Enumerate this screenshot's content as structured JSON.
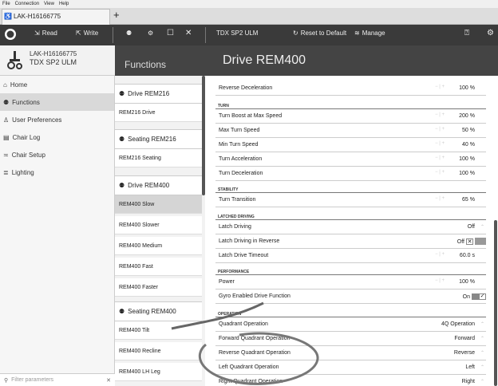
{
  "menu": [
    "File",
    "Connection",
    "View",
    "Help"
  ],
  "doc_tab": "LAK-H16166775",
  "add_tab": "+",
  "toolbar": {
    "read": "Read",
    "write": "Write",
    "product": "TDX SP2 ULM",
    "reset": "Reset to Default",
    "manage": "Manage"
  },
  "device": {
    "serial": "LAK-H16166775",
    "model": "TDX SP2 ULM"
  },
  "nav": [
    "Home",
    "Functions",
    "User Preferences",
    "Chair Log",
    "Chair Setup",
    "Lighting"
  ],
  "filter": {
    "placeholder": "Filter parameters",
    "clear": "✕"
  },
  "functions": {
    "title": "Functions",
    "groups": [
      "Drive REM216",
      "Seating REM216",
      "Drive REM400",
      "Seating REM400"
    ],
    "items": [
      "REM216 Drive",
      "REM216 Seating",
      "REM400 Slow",
      "REM400 Slower",
      "REM400 Medium",
      "REM400 Fast",
      "REM400 Faster",
      "REM400 Tilt",
      "REM400 Recline",
      "REM400 LH Leg"
    ]
  },
  "page_title": "Drive REM400",
  "sections": [
    "TURN",
    "STABILITY",
    "LATCHED DRIVING",
    "PERFORMANCE",
    "OPERATION"
  ],
  "params": [
    {
      "label": "Reverse Deceleration",
      "value": "100 %"
    },
    {
      "label": "Turn Boost at Max Speed",
      "value": "200 %"
    },
    {
      "label": "Max Turn Speed",
      "value": "50 %"
    },
    {
      "label": "Min Turn Speed",
      "value": "40 %"
    },
    {
      "label": "Turn Acceleration",
      "value": "100 %"
    },
    {
      "label": "Turn Deceleration",
      "value": "100 %"
    },
    {
      "label": "Turn Transition",
      "value": "65 %"
    },
    {
      "label": "Latch Driving",
      "value": "Off"
    },
    {
      "label": "Latch Driving in Reverse",
      "value": "Off"
    },
    {
      "label": "Latch Drive Timeout",
      "value": "60.0 s"
    },
    {
      "label": "Power",
      "value": "100 %"
    },
    {
      "label": "Gyro Enabled Drive Function",
      "value": "On"
    },
    {
      "label": "Quadrant Operation",
      "value": "4Q Operation"
    },
    {
      "label": "Forward Quadrant Operation",
      "value": "Forward"
    },
    {
      "label": "Reverse Quadrant Operation",
      "value": "Reverse"
    },
    {
      "label": "Left Quadrant Operation",
      "value": "Left"
    },
    {
      "label": "Right Quadrant Operation",
      "value": "Right"
    }
  ]
}
